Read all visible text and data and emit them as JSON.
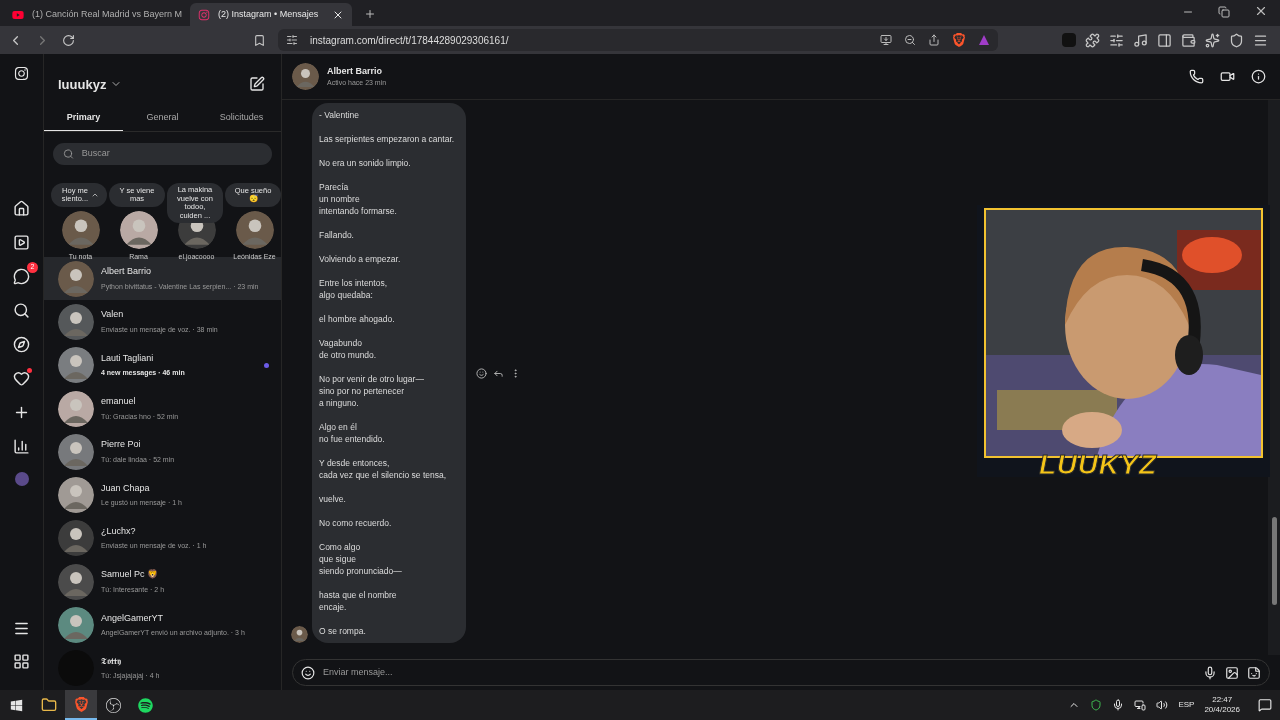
{
  "browser": {
    "tabs": [
      {
        "title": "(1) Canción Real Madrid vs Bayern M",
        "kind": "video",
        "selected": false
      },
      {
        "title": "(2) Instagram • Mensajes",
        "kind": "instagram",
        "selected": true
      }
    ],
    "url": "instagram.com/direct/t/17844289029306161/"
  },
  "rail": {
    "messages_badge": "2"
  },
  "inbox": {
    "username": "luuukyz",
    "tabs": [
      {
        "label": "Primary",
        "selected": true
      },
      {
        "label": "General",
        "selected": false
      },
      {
        "label": "Solicitudes",
        "selected": false
      }
    ],
    "search": {
      "placeholder": "Buscar"
    },
    "notes": [
      {
        "note": "Hoy me siento...",
        "name": "Tu nota",
        "own": true
      },
      {
        "note": "Y se viene mas",
        "name": "Rama",
        "own": false
      },
      {
        "note": "La makina vuelve con todoo, cuiden ...",
        "name": "el.joacoooo",
        "own": false
      },
      {
        "note": "Que sueño 😴",
        "name": "Leónidas Eze",
        "own": false
      }
    ],
    "conversations": [
      {
        "name": "Albert Barrio",
        "meta": "Python bivittatus - Valentine Las serpien... · 23 min",
        "selected": true,
        "unread": false
      },
      {
        "name": "Valen",
        "meta": "Enviaste un mensaje de voz. · 38 min",
        "selected": false,
        "unread": false
      },
      {
        "name": "Lauti Tagliani",
        "meta": "4 new messages · 46 min",
        "selected": false,
        "unread": true
      },
      {
        "name": "emanuel",
        "meta": "Tú: Gracias hno · 52 min",
        "selected": false,
        "unread": false
      },
      {
        "name": "Pierre Poi",
        "meta": "Tú: dale lindaa · 52 min",
        "selected": false,
        "unread": false
      },
      {
        "name": "Juan Chapa",
        "meta": "Le gustó un mensaje · 1 h",
        "selected": false,
        "unread": false
      },
      {
        "name": "¿Luchx?",
        "meta": "Enviaste un mensaje de voz. · 1 h",
        "selected": false,
        "unread": false
      },
      {
        "name": "Samuel Pc 🦁",
        "meta": "Tú: Interesante · 2 h",
        "selected": false,
        "unread": false
      },
      {
        "name": "AngelGamerYT",
        "meta": "AngelGamerYT envió un archivo adjunto. · 3 h",
        "selected": false,
        "unread": false
      },
      {
        "name": "𝕿𝖔𝖙𝖙𝖞",
        "meta": "Tú: Jsjajajajaj · 4 h",
        "selected": false,
        "unread": false
      }
    ]
  },
  "chat": {
    "contact": "Albert Barrio",
    "status": "Activo hace 23 min",
    "stanzas": [
      "- Valentine",
      "Las serpientes empezaron a cantar.",
      "No era un sonido limpio.",
      "Parecía\nun nombre\nintentando formarse.",
      "Fallando.",
      "Volviendo a empezar.",
      "Entre los intentos,\nalgo quedaba:",
      "el hombre ahogado.",
      "Vagabundo\nde otro mundo.",
      "No por venir de otro lugar—\nsino por no pertenecer\na ninguno.",
      "Algo en él\nno fue entendido.",
      "Y desde entonces,\ncada vez que el silencio se tensa,",
      "vuelve.",
      "No como recuerdo.",
      "Como algo\nque sigue\nsiendo pronunciado—",
      "hasta que el nombre\nencaje.",
      "O se rompa."
    ],
    "input": {
      "placeholder": "Enviar mensaje..."
    }
  },
  "overlay": {
    "label": "LUUKYZ"
  },
  "taskbar": {
    "language": "ESP",
    "time": "22:47",
    "date": "20/4/2026"
  }
}
